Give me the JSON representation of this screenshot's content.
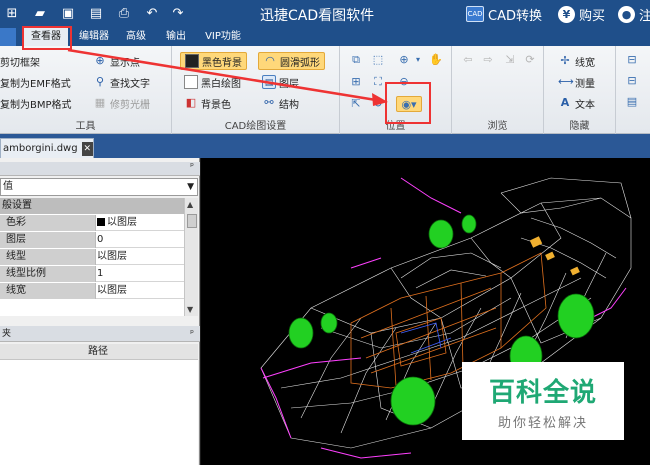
{
  "app": {
    "title": "迅捷CAD看图软件"
  },
  "titlebar_right": {
    "cad_convert": "CAD转换",
    "cad_convert_badge": "CAD",
    "buy_glyph": "¥",
    "buy": "购买",
    "login": "注"
  },
  "menu": {
    "file": "",
    "tabs": [
      {
        "label": "查看器",
        "active": true
      },
      {
        "label": "编辑器"
      },
      {
        "label": "高级"
      },
      {
        "label": "输出"
      },
      {
        "label": "VIP功能"
      }
    ]
  },
  "ribbon": {
    "tools": {
      "title": "工具",
      "items": [
        "剪切框架",
        "复制为EMF格式",
        "复制为BMP格式"
      ],
      "items2": [
        "显示点",
        "查找文字",
        "修剪光栅"
      ]
    },
    "settings": {
      "title": "CAD绘图设置",
      "items": [
        "黑色背景",
        "黑白绘图",
        "背景色"
      ],
      "items2": [
        "圆滑弧形",
        "图层",
        "结构"
      ]
    },
    "position": {
      "title": "位置"
    },
    "browse": {
      "title": "浏览"
    },
    "hide": {
      "title": "隐藏",
      "items": [
        "线宽",
        "测量",
        "文本"
      ]
    }
  },
  "file_tab": {
    "name": "amborgini.dwg",
    "close": "✕"
  },
  "properties": {
    "pin": "ᵖ",
    "combo_value": "值",
    "category": "般设置",
    "rows": [
      {
        "key": "色彩",
        "value": "以图层"
      },
      {
        "key": "图层",
        "value": "0"
      },
      {
        "key": "线型",
        "value": "以图层"
      },
      {
        "key": "线型比例",
        "value": "1"
      },
      {
        "key": "线宽",
        "value": "以图层"
      }
    ]
  },
  "layers_panel": {
    "title": "夹",
    "pin": "ᵖ",
    "col_path": "路径"
  },
  "watermark": {
    "title": "百科全说",
    "subtitle": "助你轻松解决"
  },
  "colors": {
    "titlebar": "#1f4f8a",
    "highlight": "#e33333",
    "wheel": "#22d022",
    "body_wire": "#ffffff",
    "accent_wire": "#ff40ff",
    "frame_wire": "#e0701e"
  }
}
